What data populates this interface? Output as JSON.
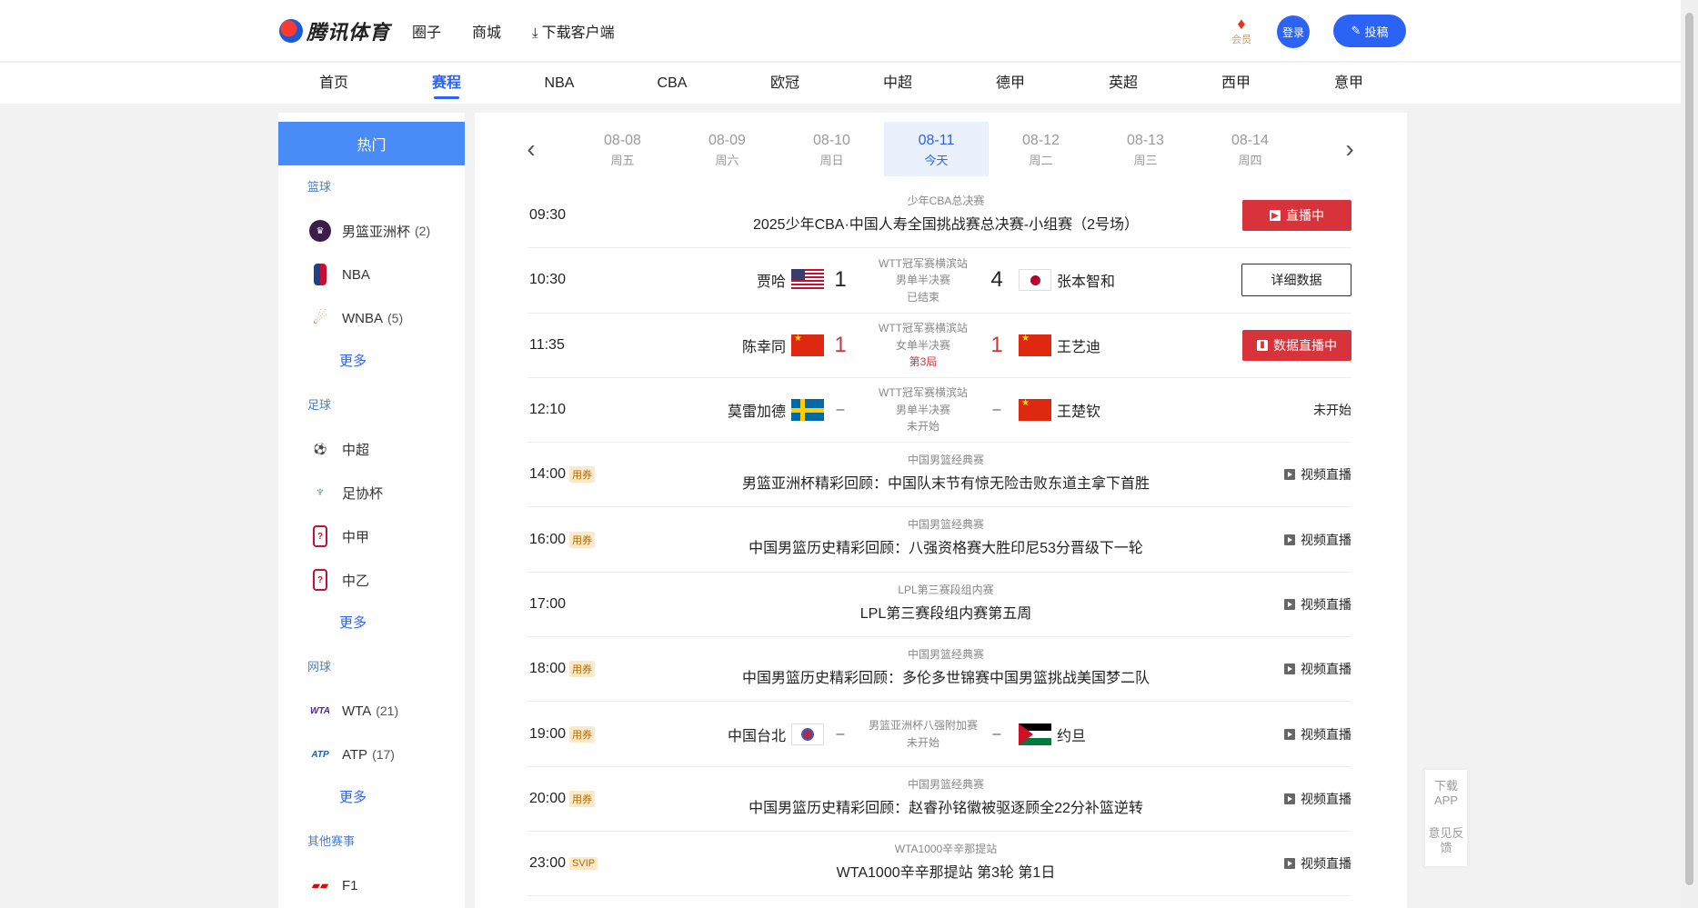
{
  "header": {
    "logo_text": "腾讯体育",
    "nav": [
      "圈子",
      "商城"
    ],
    "download_label": "下载客户端",
    "vip_label": "会员",
    "login_label": "登录",
    "post_label": "投稿"
  },
  "subnav": [
    "首页",
    "赛程",
    "NBA",
    "CBA",
    "欧冠",
    "中超",
    "德甲",
    "英超",
    "西甲",
    "意甲"
  ],
  "sidebar": {
    "hot_label": "热门",
    "more_label": "更多",
    "categories": {
      "basketball": "篮球",
      "football": "足球",
      "tennis": "网球",
      "other": "其他赛事"
    },
    "basketball_items": [
      {
        "name": "男篮亚洲杯",
        "count": "(2)"
      },
      {
        "name": "NBA",
        "count": ""
      },
      {
        "name": "WNBA",
        "count": "(5)"
      }
    ],
    "football_items": [
      {
        "name": "中超",
        "count": ""
      },
      {
        "name": "足协杯",
        "count": ""
      },
      {
        "name": "中甲",
        "count": ""
      },
      {
        "name": "中乙",
        "count": ""
      }
    ],
    "tennis_items": [
      {
        "name": "WTA",
        "count": "(21)"
      },
      {
        "name": "ATP",
        "count": "(17)"
      }
    ],
    "other_items": [
      {
        "name": "F1",
        "count": ""
      }
    ]
  },
  "dates": [
    {
      "date": "08-08",
      "weekday": "周五"
    },
    {
      "date": "08-09",
      "weekday": "周六"
    },
    {
      "date": "08-10",
      "weekday": "周日"
    },
    {
      "date": "08-11",
      "weekday": "今天"
    },
    {
      "date": "08-12",
      "weekday": "周二"
    },
    {
      "date": "08-13",
      "weekday": "周三"
    },
    {
      "date": "08-14",
      "weekday": "周四"
    }
  ],
  "rows": [
    {
      "time": "09:30",
      "league": "少年CBA总决赛",
      "title": "2025少年CBA·中国人寿全国挑战赛总决赛-小组赛（2号场）",
      "action": "直播中"
    },
    {
      "time": "10:30",
      "league": "WTT冠军赛横滨站",
      "round": "男单半决赛",
      "status": "已结束",
      "home": "贾哈",
      "away": "张本智和",
      "home_score": "1",
      "away_score": "4",
      "action": "详细数据"
    },
    {
      "time": "11:35",
      "league": "WTT冠军赛横滨站",
      "round": "女单半决赛",
      "status": "第3局",
      "home": "陈幸同",
      "away": "王艺迪",
      "home_score": "1",
      "away_score": "1",
      "action": "数据直播中"
    },
    {
      "time": "12:10",
      "league": "WTT冠军赛横滨站",
      "round": "男单半决赛",
      "status": "未开始",
      "home": "莫雷加德",
      "away": "王楚钦",
      "home_score": "–",
      "away_score": "–",
      "action": "未开始"
    },
    {
      "time": "14:00",
      "tag": "用券",
      "league": "中国男篮经典赛",
      "title": "男篮亚洲杯精彩回顾：中国队末节有惊无险击败东道主拿下首胜",
      "action": "视频直播"
    },
    {
      "time": "16:00",
      "tag": "用券",
      "league": "中国男篮经典赛",
      "title": "中国男篮历史精彩回顾：八强资格赛大胜印尼53分晋级下一轮",
      "action": "视频直播"
    },
    {
      "time": "17:00",
      "league": "LPL第三赛段组内赛",
      "title": "LPL第三赛段组内赛第五周",
      "action": "视频直播"
    },
    {
      "time": "18:00",
      "tag": "用券",
      "league": "中国男篮经典赛",
      "title": "中国男篮历史精彩回顾：多伦多世锦赛中国男篮挑战美国梦二队",
      "action": "视频直播"
    },
    {
      "time": "19:00",
      "tag": "用券",
      "league": "男篮亚洲杯八强附加赛",
      "status": "未开始",
      "home": "中国台北",
      "away": "约旦",
      "home_score": "–",
      "away_score": "–",
      "action": "视频直播"
    },
    {
      "time": "20:00",
      "tag": "用券",
      "league": "中国男篮经典赛",
      "title": "中国男篮历史精彩回顾：赵睿孙铭徽被驱逐顾全22分补篮逆转",
      "action": "视频直播"
    },
    {
      "time": "23:00",
      "tag": "SVIP",
      "league": "WTA1000辛辛那提站",
      "title": "WTA1000辛辛那提站 第3轮 第1日",
      "action": "视频直播"
    }
  ],
  "float": {
    "download": "下载APP",
    "feedback": "意见反馈"
  },
  "colors": {
    "accent": "#2b63f6",
    "live_red": "#d8333a",
    "sidebar_hot": "#4a8cf7"
  }
}
